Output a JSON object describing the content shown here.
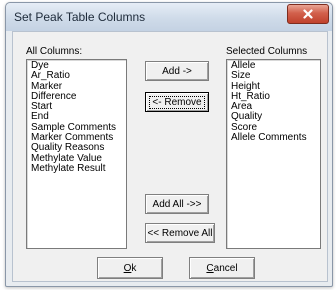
{
  "window": {
    "title": "Set Peak Table Columns"
  },
  "all_columns": {
    "label": "All Columns:",
    "items": [
      "Dye",
      "Ar_Ratio",
      "Marker",
      "Difference",
      "Start",
      "End",
      "Sample Comments",
      "Marker Comments",
      "Quality Reasons",
      "Methylate Value",
      "Methylate Result"
    ]
  },
  "selected_columns": {
    "label": "Selected Columns",
    "items": [
      "Allele",
      "Size",
      "Height",
      "Ht_Ratio",
      "Area",
      "Quality",
      "Score",
      "Allele Comments"
    ]
  },
  "buttons": {
    "add": "Add ->",
    "remove": "<- Remove",
    "add_all": "Add All ->>",
    "remove_all": "<< Remove All",
    "ok_mnemonic": "O",
    "ok_rest": "k",
    "cancel_mnemonic": "C",
    "cancel_rest": "ancel"
  },
  "icons": {
    "close": "close-x-icon"
  }
}
